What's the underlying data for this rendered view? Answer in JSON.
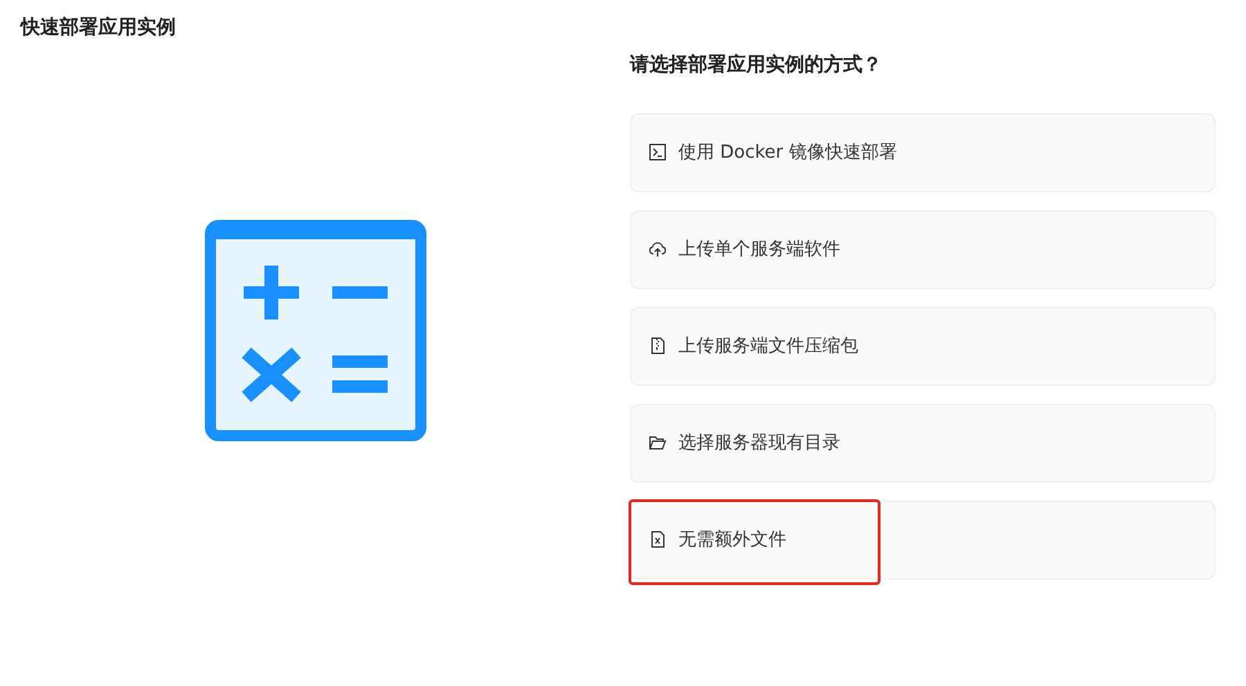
{
  "title": "快速部署应用实例",
  "question": "请选择部署应用实例的方式？",
  "options": [
    {
      "kind": "terminal",
      "label": "使用 Docker 镜像快速部署",
      "highlighted": false
    },
    {
      "kind": "upload",
      "label": "上传单个服务端软件",
      "highlighted": false
    },
    {
      "kind": "archive",
      "label": "上传服务端文件压缩包",
      "highlighted": false
    },
    {
      "kind": "folder",
      "label": "选择服务器现有目录",
      "highlighted": false
    },
    {
      "kind": "blank-file",
      "label": "无需额外文件",
      "highlighted": true
    }
  ]
}
